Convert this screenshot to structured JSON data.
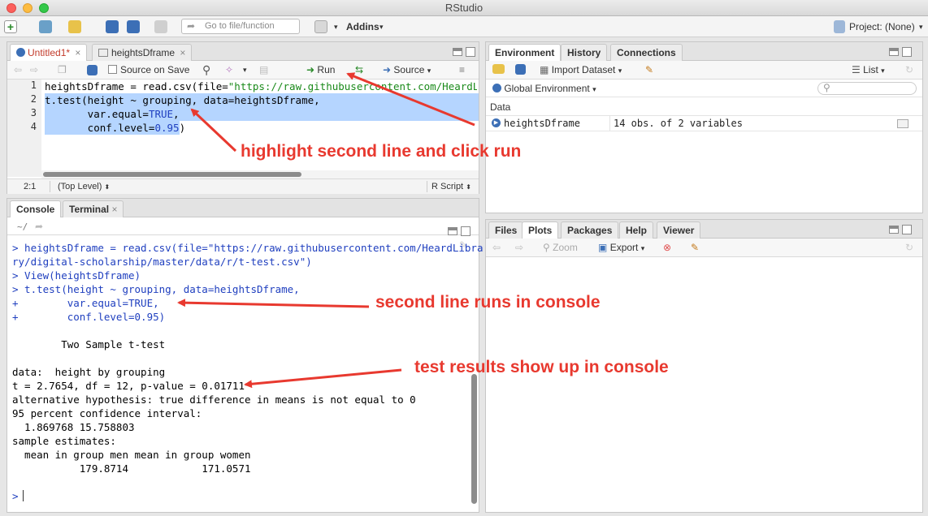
{
  "window": {
    "title": "RStudio"
  },
  "toolbar": {
    "goto_placeholder": "Go to file/function",
    "addins": "Addins",
    "project": "Project: (None)"
  },
  "editor": {
    "tabs": [
      {
        "label": "Untitled1*"
      },
      {
        "label": "heightsDframe"
      }
    ],
    "source_on_save": "Source on Save",
    "run": "Run",
    "source": "Source",
    "lines": [
      {
        "num": "1",
        "pre": "heightsDframe = read.csv(file=",
        "str": "\"https://raw.githubusercontent.com/HeardLibra"
      },
      {
        "num": "2",
        "text": "t.test(height ~ grouping, data=heightsDframe,"
      },
      {
        "num": "3",
        "pre": "       var.equal=",
        "kw": "TRUE",
        "post": ","
      },
      {
        "num": "4",
        "pre": "       conf.level=",
        "kw": "0.95",
        "post": ")"
      }
    ],
    "status_pos": "2:1",
    "status_level": "(Top Level)",
    "status_type": "R Script"
  },
  "console": {
    "tabs": [
      {
        "label": "Console"
      },
      {
        "label": "Terminal"
      }
    ],
    "path": "~/",
    "lines": [
      "> heightsDframe = read.csv(file=\"https://raw.githubusercontent.com/HeardLibra",
      "ry/digital-scholarship/master/data/r/t-test.csv\")",
      "> View(heightsDframe)",
      "> t.test(height ~ grouping, data=heightsDframe,",
      "+        var.equal=TRUE,",
      "+        conf.level=0.95)",
      "",
      "        Two Sample t-test",
      "",
      "data:  height by grouping",
      "t = 2.7654, df = 12, p-value = 0.01711",
      "alternative hypothesis: true difference in means is not equal to 0",
      "95 percent confidence interval:",
      "  1.869768 15.758803",
      "sample estimates:",
      "  mean in group men mean in group women",
      "           179.8714            171.0571",
      "",
      ">"
    ]
  },
  "environment": {
    "tabs": [
      {
        "label": "Environment"
      },
      {
        "label": "History"
      },
      {
        "label": "Connections"
      }
    ],
    "import_dataset": "Import Dataset",
    "list_view": "List",
    "global_env": "Global Environment",
    "section": "Data",
    "rows": [
      {
        "name": "heightsDframe",
        "desc": "14 obs. of 2 variables"
      }
    ]
  },
  "files": {
    "tabs": [
      {
        "label": "Files"
      },
      {
        "label": "Plots"
      },
      {
        "label": "Packages"
      },
      {
        "label": "Help"
      },
      {
        "label": "Viewer"
      }
    ],
    "zoom": "Zoom",
    "export": "Export"
  },
  "annotations": {
    "a1": "highlight second line and click run",
    "a2": "second line runs in console",
    "a3": "test results show up in console"
  },
  "colors": {
    "accent": "#e8392f",
    "selection": "#b5d5ff",
    "string": "#1a8a1a",
    "keyword": "#1f3fbf"
  }
}
